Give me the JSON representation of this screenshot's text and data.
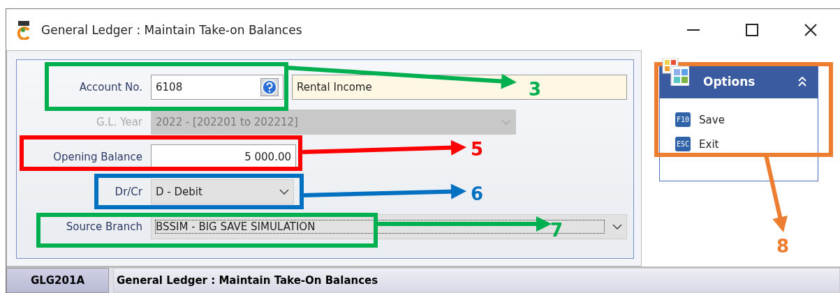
{
  "window": {
    "title": "General Ledger : Maintain Take-on Balances"
  },
  "form": {
    "fields": [
      {
        "kind": "lookup",
        "label": "Account No.",
        "value": "6108",
        "description": "Rental Income",
        "disabled": false
      },
      {
        "kind": "select",
        "label": "G.L. Year",
        "value": "2022 - [202201 to 202212]",
        "disabled": true
      },
      {
        "kind": "amount",
        "label": "Opening Balance",
        "value": "5 000.00",
        "disabled": false
      },
      {
        "kind": "select",
        "label": "Dr/Cr",
        "value": "D - Debit",
        "disabled": false
      },
      {
        "kind": "select",
        "label": "Source Branch",
        "value": "BSSIM - BIG SAVE SIMULATION",
        "disabled": false
      }
    ]
  },
  "options": {
    "title": "Options",
    "expanded": true,
    "items": [
      {
        "key": "F10",
        "label": "Save"
      },
      {
        "key": "ESC",
        "label": "Exit"
      }
    ]
  },
  "status_bar": {
    "code": "GLG201A",
    "title": "General Ledger : Maintain Take-On Balances"
  },
  "annotations": [
    {
      "label": "3",
      "color": "#00b050"
    },
    {
      "label": "5",
      "color": "#ff0000"
    },
    {
      "label": "6",
      "color": "#0070c0"
    },
    {
      "label": "7",
      "color": "#00b050"
    },
    {
      "label": "8",
      "color": "#ed7d31"
    }
  ]
}
